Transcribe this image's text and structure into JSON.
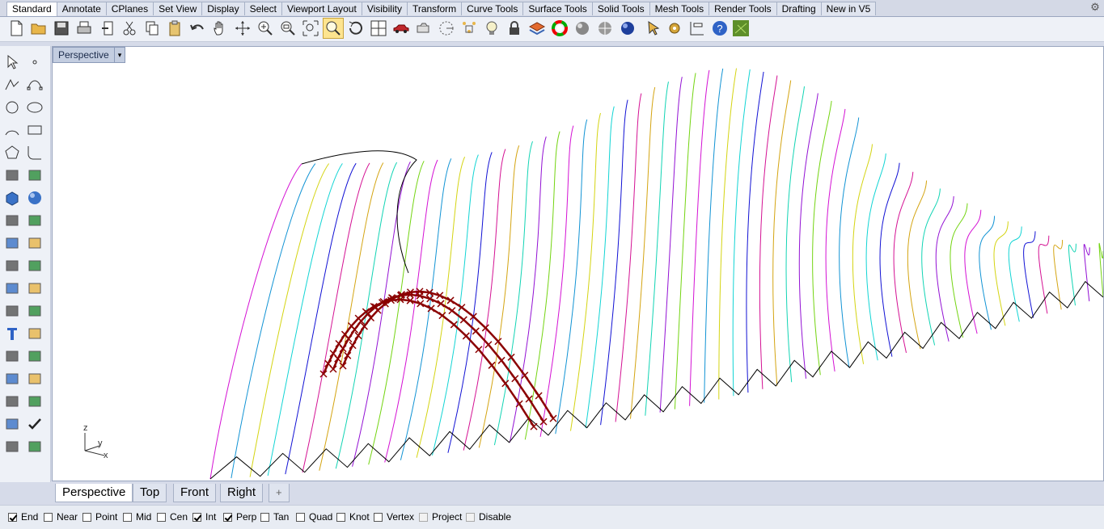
{
  "menu_tabs": [
    "Standard",
    "Annotate",
    "CPlanes",
    "Set View",
    "Display",
    "Select",
    "Viewport Layout",
    "Visibility",
    "Transform",
    "Curve Tools",
    "Surface Tools",
    "Solid Tools",
    "Mesh Tools",
    "Render Tools",
    "Drafting",
    "New in V5"
  ],
  "active_tab": "Standard",
  "toolbar_icons": [
    "new-file-icon",
    "open-folder-icon",
    "save-icon",
    "print-icon",
    "import-icon",
    "cut-icon",
    "copy-icon",
    "paste-icon",
    "undo-icon",
    "pan-hand-icon",
    "rotate-view-icon",
    "zoom-in-icon",
    "zoom-window-icon",
    "zoom-extents-icon",
    "zoom-selected-icon",
    "rotate-3d-icon",
    "four-viewports-icon",
    "car-named-view-icon",
    "camera-icon",
    "cplane-icon",
    "points-icon",
    "light-bulb-icon",
    "lock-icon",
    "layer-icon",
    "color-wheel-icon",
    "shaded-sphere-icon",
    "rendered-sphere-icon",
    "blue-sphere-icon",
    "mouse-cursor-icon",
    "options-gear-icon",
    "align-icon",
    "help-icon",
    "grasshopper-icon"
  ],
  "left_icons": [
    "select-arrow-icon",
    "point-icon",
    "polyline-icon",
    "curve-cp-icon",
    "circle-icon",
    "ellipse-icon",
    "arc-icon",
    "rectangle-icon",
    "polygon-icon",
    "fillet-curve-icon",
    "surface-corner-icon",
    "surface-edge-icon",
    "box-icon",
    "sphere-icon",
    "cylinder-icon",
    "planar-surface-icon",
    "explode-icon",
    "trim-icon",
    "split-icon",
    "boolean-icon",
    "group-icon",
    "ungroup-icon",
    "extend-icon",
    "offset-icon",
    "text-icon",
    "scale-icon",
    "array-icon",
    "mirror-icon",
    "block-icon",
    "dimension-icon",
    "grid-array-icon",
    "orient-icon",
    "paper-icon",
    "check-icon",
    "solid-shape-icon",
    "pencil-icon"
  ],
  "viewport": {
    "label": "Perspective",
    "dropdown": "▾"
  },
  "axes": {
    "z": "z",
    "y": "y",
    "x": "x"
  },
  "viewport_tabs": [
    "Perspective",
    "Top",
    "Front",
    "Right"
  ],
  "add_tab": "+",
  "osnaps": [
    {
      "label": "End",
      "checked": true
    },
    {
      "label": "Near",
      "checked": false
    },
    {
      "label": "Point",
      "checked": false
    },
    {
      "label": "Mid",
      "checked": false
    },
    {
      "label": "Cen",
      "checked": false
    },
    {
      "label": "Int",
      "checked": true
    },
    {
      "label": "Perp",
      "checked": true
    },
    {
      "label": "Tan",
      "checked": false
    },
    {
      "label": "Quad",
      "checked": false
    },
    {
      "label": "Knot",
      "checked": false
    },
    {
      "label": "Vertex",
      "checked": false
    },
    {
      "label": "Project",
      "checked": false,
      "disabled": true
    },
    {
      "label": "Disable",
      "checked": false,
      "disabled": true
    }
  ],
  "colors": {
    "curve_marker": "#8b0000",
    "edge": "#000000",
    "selected_tab": "#ffffff"
  }
}
